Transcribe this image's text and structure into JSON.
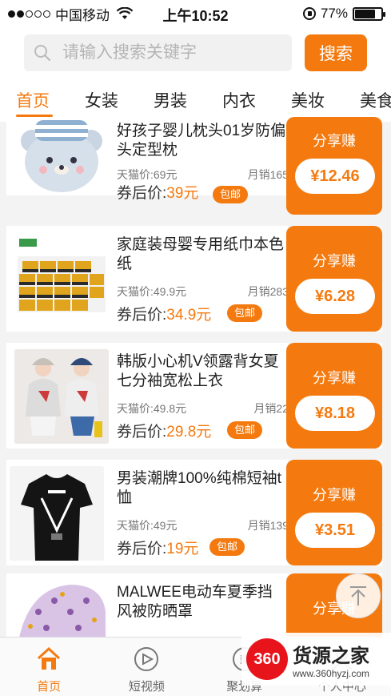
{
  "status": {
    "carrier": "中国移动",
    "time": "上午10:52",
    "battery": "77%",
    "battery_level": 0.77
  },
  "search": {
    "placeholder": "请输入搜索关键字",
    "button": "搜索"
  },
  "tabs": [
    {
      "label": "首页",
      "active": true
    },
    {
      "label": "女装"
    },
    {
      "label": "男装"
    },
    {
      "label": "内衣"
    },
    {
      "label": "美妆"
    },
    {
      "label": "美食"
    }
  ],
  "products": [
    {
      "title": "好孩子婴儿枕头01岁防偏头定型枕",
      "tmall_price": "天猫价:69元",
      "sales": "月销165",
      "coupon_label": "券后价:",
      "coupon_price": "39元",
      "ship": "包邮",
      "share_title": "分享赚",
      "share_amount": "¥12.46"
    },
    {
      "title": "家庭装母婴专用纸巾本色纸",
      "tmall_price": "天猫价:49.9元",
      "sales": "月销283",
      "coupon_label": "券后价:",
      "coupon_price": "34.9元",
      "ship": "包邮",
      "share_title": "分享赚",
      "share_amount": "¥6.28"
    },
    {
      "title": "韩版小心机V领露背女夏七分袖宽松上衣",
      "tmall_price": "天猫价:49.8元",
      "sales": "月销22",
      "coupon_label": "券后价:",
      "coupon_price": "29.8元",
      "ship": "包邮",
      "share_title": "分享赚",
      "share_amount": "¥8.18"
    },
    {
      "title": "男装潮牌100%纯棉短袖t恤",
      "tmall_price": "天猫价:49元",
      "sales": "月销139",
      "coupon_label": "券后价:",
      "coupon_price": "19元",
      "ship": "包邮",
      "share_title": "分享赚",
      "share_amount": "¥3.51"
    },
    {
      "title": "MALWEE电动车夏季挡风被防晒罩",
      "share_title": "分享赚"
    }
  ],
  "bottom_nav": [
    {
      "label": "首页",
      "icon": "home-icon",
      "active": true
    },
    {
      "label": "短视频",
      "icon": "play-icon"
    },
    {
      "label": "聚划算",
      "icon": "deal-icon"
    },
    {
      "label": "个人中心",
      "icon": "user-icon"
    }
  ],
  "watermark": {
    "logo": "360",
    "name": "货源之家",
    "url": "www.360hyzj.com"
  },
  "colors": {
    "accent": "#f47a0f"
  }
}
